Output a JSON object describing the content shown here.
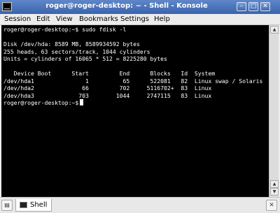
{
  "window": {
    "title": "roger@roger-desktop: ~ - Shell - Konsole"
  },
  "menubar": {
    "items": [
      "Session",
      "Edit",
      "View",
      "Bookmarks",
      "Settings",
      "Help"
    ]
  },
  "terminal": {
    "lines": [
      "roger@roger-desktop:~$ sudo fdisk -l",
      "",
      "Disk /dev/hda: 8589 MB, 8589934592 bytes",
      "255 heads, 63 sectors/track, 1044 cylinders",
      "Units = cylinders of 16065 * 512 = 8225280 bytes",
      "",
      "   Device Boot      Start         End      Blocks   Id  System",
      "/dev/hda1               1          65      522081   82  Linux swap / Solaris",
      "/dev/hda2              66         702     5116702+  83  Linux",
      "/dev/hda3             703        1044     2747115   83  Linux"
    ],
    "prompt": "roger@roger-desktop:~$"
  },
  "tabbar": {
    "tab_label": "Shell"
  },
  "colors": {
    "terminal_bg": "#000000",
    "terminal_fg": "#ffffff",
    "titlebar": "#4a72b8"
  }
}
